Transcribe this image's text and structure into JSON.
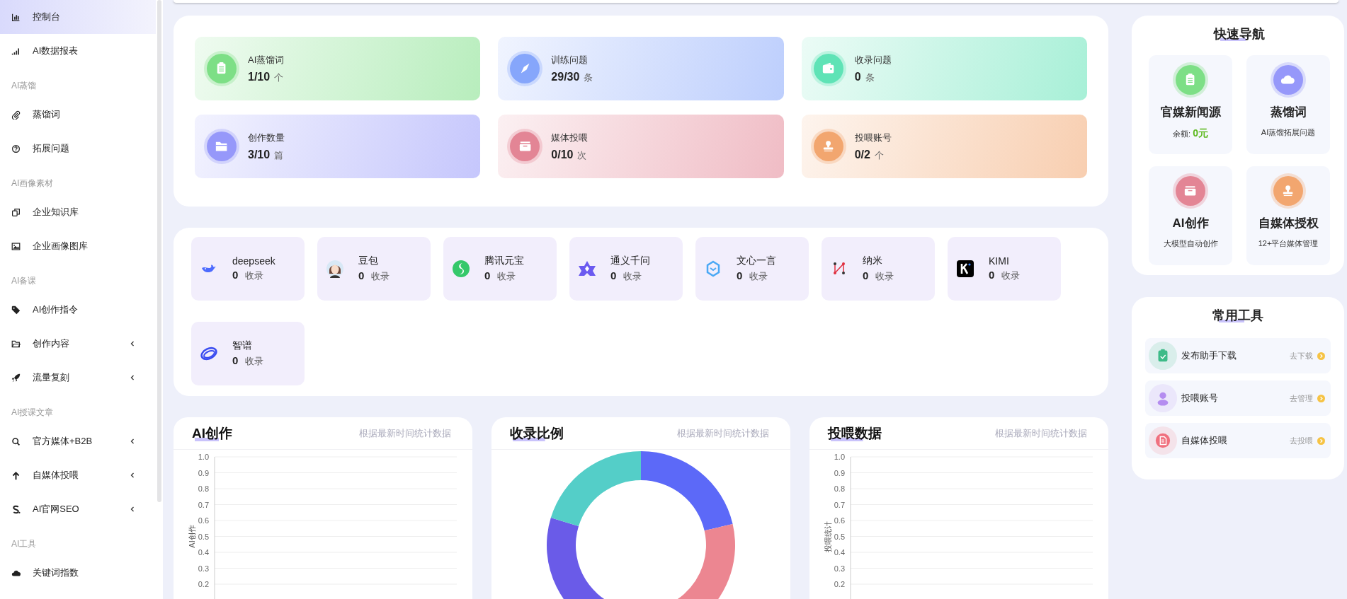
{
  "sidebar": {
    "sections": [
      {
        "items": [
          {
            "label": "控制台",
            "kind": "link",
            "selected": true
          },
          {
            "label": "AI数据报表",
            "kind": "link",
            "selected": false
          }
        ]
      },
      {
        "heading": "AI蒸馏",
        "items": [
          {
            "label": "蒸馏词",
            "kind": "link",
            "selected": false
          },
          {
            "label": "拓展问题",
            "kind": "link",
            "selected": false
          }
        ]
      },
      {
        "heading": "AI画像素材",
        "items": [
          {
            "label": "企业知识库",
            "kind": "link",
            "selected": false
          },
          {
            "label": "企业画像图库",
            "kind": "link",
            "selected": false
          }
        ]
      },
      {
        "heading": "AI备课",
        "items": [
          {
            "label": "AI创作指令",
            "kind": "link",
            "selected": false
          },
          {
            "label": "创作内容",
            "kind": "submenu",
            "selected": false,
            "expanded": false
          },
          {
            "label": "流量复刻",
            "kind": "submenu",
            "selected": false,
            "expanded": false
          }
        ]
      },
      {
        "heading": "AI授课文章",
        "items": [
          {
            "label": "官方媒体+B2B",
            "kind": "submenu",
            "selected": false,
            "expanded": false
          },
          {
            "label": "自媒体投喂",
            "kind": "submenu",
            "selected": false,
            "expanded": false
          },
          {
            "label": "AI官网SEO",
            "kind": "submenu",
            "selected": false,
            "expanded": false
          }
        ]
      },
      {
        "heading": "AI工具",
        "items": [
          {
            "label": "关键词指数",
            "kind": "link",
            "selected": false
          }
        ]
      }
    ]
  },
  "stats": [
    {
      "label": "AI蒸馏词",
      "value": "1/10",
      "unit": "个",
      "color": "#7ddf86"
    },
    {
      "label": "训练问题",
      "value": "29/30",
      "unit": "条",
      "color": "#86a6fb"
    },
    {
      "label": "收录问题",
      "value": "0",
      "unit": "条",
      "color": "#5fe3b6"
    },
    {
      "label": "创作数量",
      "value": "3/10",
      "unit": "篇",
      "color": "#9698fa"
    },
    {
      "label": "媒体投喂",
      "value": "0/10",
      "unit": "次",
      "color": "#e38595"
    },
    {
      "label": "投喂账号",
      "value": "0/2",
      "unit": "个",
      "color": "#f2a66f"
    }
  ],
  "models": [
    {
      "name": "deepseek",
      "count": "0",
      "unit": "收录"
    },
    {
      "name": "豆包",
      "count": "0",
      "unit": "收录"
    },
    {
      "name": "腾讯元宝",
      "count": "0",
      "unit": "收录"
    },
    {
      "name": "通义千问",
      "count": "0",
      "unit": "收录"
    },
    {
      "name": "文心一言",
      "count": "0",
      "unit": "收录"
    },
    {
      "name": "纳米",
      "count": "0",
      "unit": "收录"
    },
    {
      "name": "KIMI",
      "count": "0",
      "unit": "收录"
    },
    {
      "name": "智谱",
      "count": "0",
      "unit": "收录"
    }
  ],
  "charts": [
    {
      "kind": "axes",
      "title": "AI创作",
      "note": "根据最新时间统计数据",
      "chart_data": {
        "type": "line",
        "categories": [
          null
        ],
        "ylabel": "AI创作",
        "grid": true,
        "ylim": [
          0.1,
          1
        ],
        "yticks": [
          {
            "value": 0.2,
            "label": "0.2"
          },
          {
            "value": 0.3,
            "label": "0.3"
          },
          {
            "value": 0.4,
            "label": "0.4"
          },
          {
            "value": 0.5,
            "label": "0.5"
          },
          {
            "value": 0.6,
            "label": "0.6"
          },
          {
            "value": 0.7,
            "label": "0.7"
          },
          {
            "value": 0.8,
            "label": "0.8"
          },
          {
            "value": 0.9,
            "label": "0.9"
          },
          {
            "value": 1,
            "label": "1.0"
          }
        ]
      }
    },
    {
      "kind": "donut",
      "title": "收录比例",
      "note": "根据最新时间统计数据"
    },
    {
      "kind": "axes",
      "title": "投喂数据",
      "note": "根据最新时间统计数据",
      "chart_data": {
        "type": "line",
        "categories": [
          null
        ],
        "ylabel": "投喂统计",
        "grid": true,
        "ylim": [
          0.1,
          1
        ],
        "yticks": [
          {
            "value": 0.2,
            "label": "0.2"
          },
          {
            "value": 0.3,
            "label": "0.3"
          },
          {
            "value": 0.4,
            "label": "0.4"
          },
          {
            "value": 0.5,
            "label": "0.5"
          },
          {
            "value": 0.6,
            "label": "0.6"
          },
          {
            "value": 0.7,
            "label": "0.7"
          },
          {
            "value": 0.8,
            "label": "0.8"
          },
          {
            "value": 0.9,
            "label": "0.9"
          },
          {
            "value": 1,
            "label": "1.0"
          }
        ]
      }
    }
  ],
  "quick_nav": {
    "title": "快速导航",
    "tiles": [
      {
        "title": "官媒新闻源",
        "subtitle": "余额: **0元**",
        "color": "#7ddf86"
      },
      {
        "title": "蒸馏词",
        "subtitle": "AI蒸馏拓展问题",
        "color": "#9698fa"
      },
      {
        "title": "AI创作",
        "subtitle": "大模型自动创作",
        "color": "#e38595"
      },
      {
        "title": "自媒体授权",
        "subtitle": "12+平台媒体管理",
        "color": "#f2a66f"
      }
    ]
  },
  "tools": {
    "title": "常用工具",
    "items": [
      {
        "label": "发布助手下载",
        "action": "去下载",
        "color": "#3dbb88"
      },
      {
        "label": "投喂账号",
        "action": "去管理",
        "color": "#b48cf0"
      },
      {
        "label": "自媒体投喂",
        "action": "去投喂",
        "color": "#f0707e"
      }
    ]
  }
}
